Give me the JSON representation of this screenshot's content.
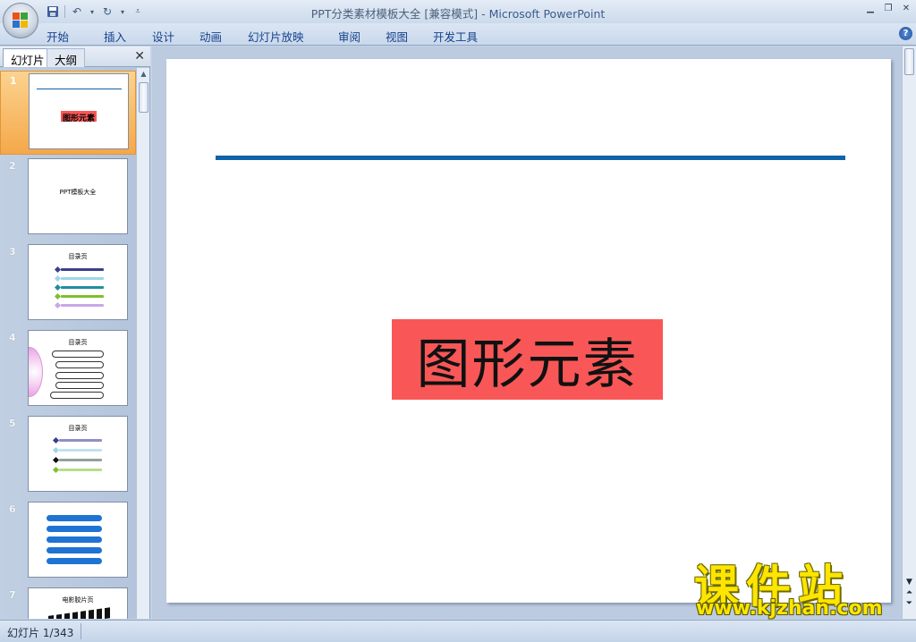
{
  "window": {
    "title_doc": "PPT分类素材模板大全 [兼容模式]",
    "title_sep": " - ",
    "title_app": "Microsoft PowerPoint",
    "controls": [
      "minimize-icon",
      "restore-icon",
      "close-icon"
    ]
  },
  "quick_access": {
    "save": "save-icon",
    "undo": "undo-icon",
    "redo": "redo-icon",
    "customize": "customize-qat-icon"
  },
  "ribbon": {
    "tabs": [
      "开始",
      "插入",
      "设计",
      "动画",
      "幻灯片放映",
      "审阅",
      "视图",
      "开发工具"
    ],
    "help": "?"
  },
  "left_pane": {
    "tabs": [
      "幻灯片",
      "大纲"
    ],
    "close": "✕",
    "thumbnails": [
      {
        "number": "1",
        "title": "图形元素",
        "selected": true
      },
      {
        "number": "2",
        "title": "PPT模板大全"
      },
      {
        "number": "3",
        "title": "目录页"
      },
      {
        "number": "4",
        "title": "目录页"
      },
      {
        "number": "5",
        "title": "目录页"
      },
      {
        "number": "6",
        "title": ""
      },
      {
        "number": "7",
        "title": "电影胶片页"
      }
    ]
  },
  "slide": {
    "title": "图形元素",
    "colors": {
      "line": "#0f63a8",
      "title_fill": "#f95757"
    }
  },
  "status": {
    "slide_indicator": "幻灯片 1/343"
  },
  "watermark": {
    "cn": "课件站",
    "url": "www.kjzhan.com"
  }
}
